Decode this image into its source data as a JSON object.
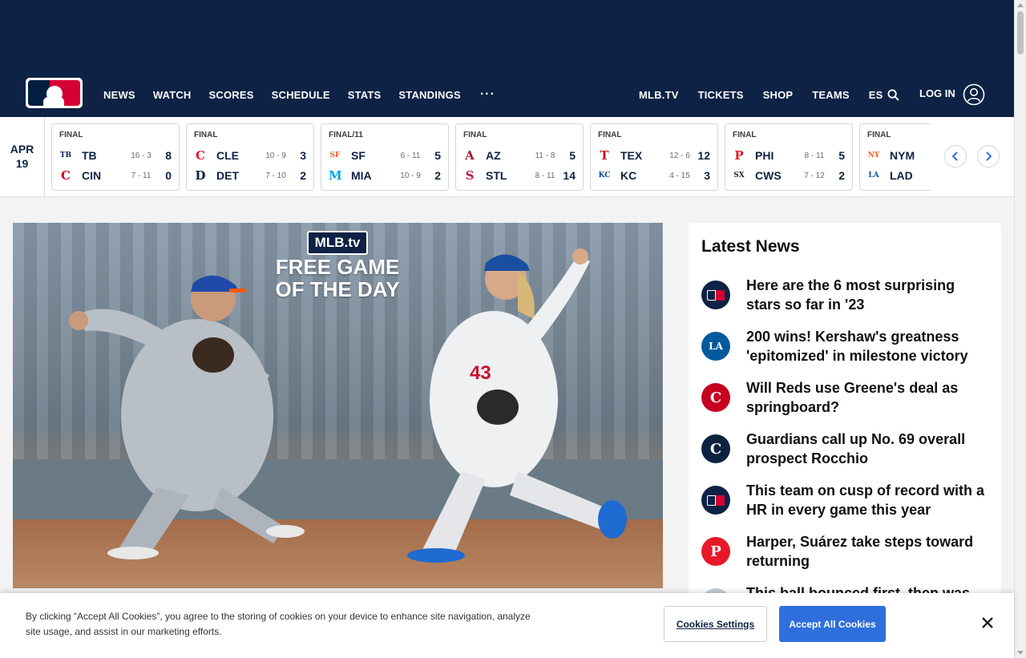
{
  "nav": {
    "left": [
      "NEWS",
      "WATCH",
      "SCORES",
      "SCHEDULE",
      "STATS",
      "STANDINGS"
    ],
    "more": "···",
    "right": [
      "MLB.TV",
      "TICKETS",
      "SHOP",
      "TEAMS",
      "ES"
    ],
    "login": "LOG IN"
  },
  "scores": {
    "date_month": "APR",
    "date_day": "19",
    "games": [
      {
        "status": "FINAL",
        "away": {
          "abbr": "TB",
          "logo": "TB",
          "color": "#092c5c",
          "record": "16 - 3",
          "runs": "8"
        },
        "home": {
          "abbr": "CIN",
          "logo": "C",
          "color": "#c6011f",
          "record": "7 - 11",
          "runs": "0"
        }
      },
      {
        "status": "FINAL",
        "away": {
          "abbr": "CLE",
          "logo": "C",
          "color": "#e31937",
          "record": "10 - 9",
          "runs": "3"
        },
        "home": {
          "abbr": "DET",
          "logo": "D",
          "color": "#0c2340",
          "record": "7 - 10",
          "runs": "2"
        }
      },
      {
        "status": "FINAL/11",
        "away": {
          "abbr": "SF",
          "logo": "SF",
          "color": "#fd5a1e",
          "record": "6 - 11",
          "runs": "5"
        },
        "home": {
          "abbr": "MIA",
          "logo": "M",
          "color": "#00a3e0",
          "record": "10 - 9",
          "runs": "2"
        }
      },
      {
        "status": "FINAL",
        "away": {
          "abbr": "AZ",
          "logo": "A",
          "color": "#a71930",
          "record": "11 - 8",
          "runs": "5"
        },
        "home": {
          "abbr": "STL",
          "logo": "S",
          "color": "#c41e3a",
          "record": "8 - 11",
          "runs": "14"
        }
      },
      {
        "status": "FINAL",
        "away": {
          "abbr": "TEX",
          "logo": "T",
          "color": "#c0111f",
          "record": "12 - 6",
          "runs": "12"
        },
        "home": {
          "abbr": "KC",
          "logo": "KC",
          "color": "#004687",
          "record": "4 - 15",
          "runs": "3"
        }
      },
      {
        "status": "FINAL",
        "away": {
          "abbr": "PHI",
          "logo": "P",
          "color": "#e81828",
          "record": "8 - 11",
          "runs": "5"
        },
        "home": {
          "abbr": "CWS",
          "logo": "SX",
          "color": "#27251f",
          "record": "7 - 12",
          "runs": "2"
        }
      },
      {
        "status": "FINAL",
        "away": {
          "abbr": "NYM",
          "logo": "NY",
          "color": "#ff5910",
          "record": "",
          "runs": ""
        },
        "home": {
          "abbr": "LAD",
          "logo": "LA",
          "color": "#005a9c",
          "record": "",
          "runs": ""
        }
      }
    ]
  },
  "hero": {
    "badge": "MLB.tv",
    "line1": "FREE GAME",
    "line2": "OF THE DAY"
  },
  "news": {
    "title": "Latest News",
    "items": [
      {
        "text": "Here are the 6 most surprising stars so far in '23",
        "icon": "mlb-logo-icon",
        "bg": "#0d2244",
        "glyph": ""
      },
      {
        "text": "200 wins! Kershaw's greatness 'epitomized' in milestone victory",
        "icon": "dodgers-logo-icon",
        "bg": "#005a9c",
        "glyph": "LA"
      },
      {
        "text": "Will Reds use Greene's deal as springboard?",
        "icon": "reds-logo-icon",
        "bg": "#c6011f",
        "glyph": "C"
      },
      {
        "text": "Guardians call up No. 69 overall prospect Rocchio",
        "icon": "guardians-logo-icon",
        "bg": "#0c2340",
        "glyph": "C"
      },
      {
        "text": "This team on cusp of record with a HR in every game this year",
        "icon": "mlb-logo-icon",
        "bg": "#0d2244",
        "glyph": ""
      },
      {
        "text": "Harper, Suárez take steps toward returning",
        "icon": "phillies-logo-icon",
        "bg": "#e81828",
        "glyph": "P"
      },
      {
        "text": "This ball bounced first, then was",
        "icon": "team-logo-icon",
        "bg": "#c4ced4",
        "glyph": ""
      }
    ]
  },
  "cookie": {
    "message": "By clicking “Accept All Cookies”, you agree to the storing of cookies on your device to enhance site navigation, analyze site usage, and assist in our marketing efforts.",
    "settings": "Cookies Settings",
    "accept": "Accept All Cookies"
  }
}
